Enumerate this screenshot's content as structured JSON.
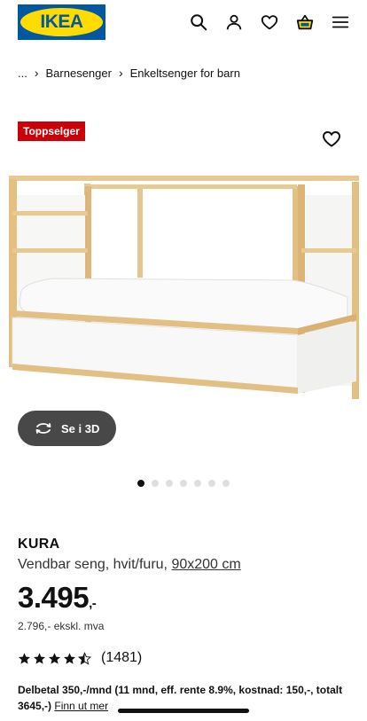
{
  "header": {
    "logo_text": "IKEA",
    "icons": [
      "search-icon",
      "user-icon",
      "heart-icon",
      "basket-icon",
      "menu-icon"
    ],
    "brand_blue": "#0058a3",
    "brand_yellow": "#ffdb00"
  },
  "breadcrumb": {
    "ellipsis": "...",
    "items": [
      "Barnesenger",
      "Enkeltsenger for barn"
    ]
  },
  "badge": {
    "label": "Toppselger",
    "color": "#cc0008"
  },
  "view3d": {
    "label": "Se i 3D"
  },
  "carousel": {
    "total": 7,
    "active": 1
  },
  "product": {
    "name": "KURA",
    "description": "Vendbar seng, hvit/furu,",
    "size": "90x200 cm",
    "price": "3.495",
    "price_suffix": ",-",
    "price_ex_vat": "2.796,- ekskl. mva",
    "rating": 4.5,
    "rating_count": "(1481)"
  },
  "installment": {
    "text": "Delbetal 350,-/mnd (11 mnd, eff. rente 8.9%, kostnad: 150,-, totalt 3645,-)",
    "link": "Finn ut mer"
  }
}
